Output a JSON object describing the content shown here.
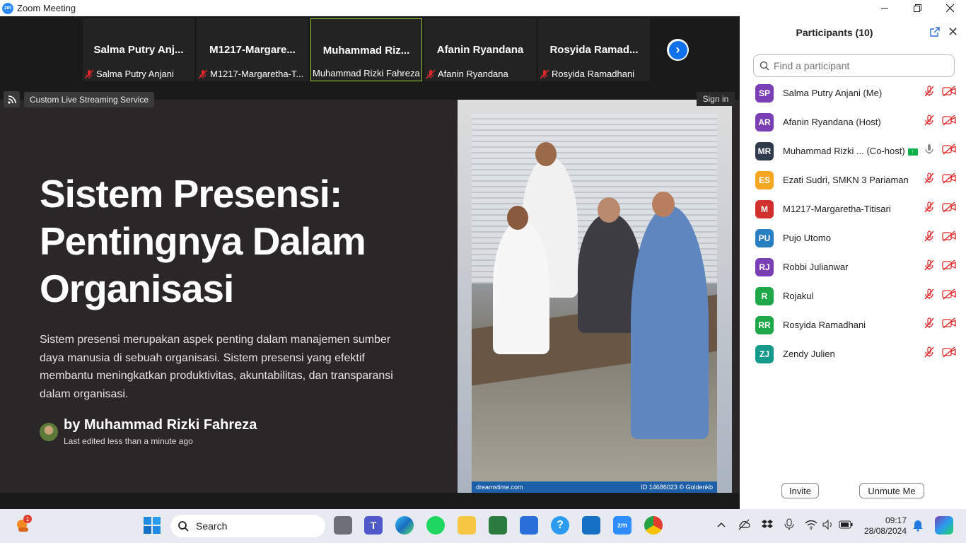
{
  "window": {
    "title": "Zoom Meeting",
    "app_badge": "zm"
  },
  "strip": {
    "tiles": [
      {
        "name": "Salma  Putry  Anj...",
        "label": "Salma Putry Anjani",
        "muted": true
      },
      {
        "name": "M1217-Margare...",
        "label": "M1217-Margaretha-T...",
        "muted": true
      },
      {
        "name": "Muhammad  Riz...",
        "label": "Muhammad Rizki Fahreza",
        "muted": false
      },
      {
        "name": "Afanin Ryandana",
        "label": "Afanin Ryandana",
        "muted": true
      },
      {
        "name": "Rosyida  Ramad...",
        "label": "Rosyida Ramadhani",
        "muted": true
      }
    ]
  },
  "live": {
    "label": "Custom Live Streaming Service"
  },
  "signin": "Sign in",
  "slide": {
    "title": "Sistem Presensi: Pentingnya Dalam Organisasi",
    "paragraph": "Sistem presensi merupakan aspek penting dalam manajemen sumber daya manusia di sebuah organisasi. Sistem presensi yang efektif membantu meningkatkan produktivitas, akuntabilitas, dan transparansi dalam organisasi.",
    "author": "by Muhammad Rizki Fahreza",
    "edited": "Last edited less than a minute ago",
    "photo_caption_left": "dreamstime.com",
    "photo_caption_right": "ID 14686023 © Goldenkb"
  },
  "participants": {
    "title": "Participants (10)",
    "search_placeholder": "Find a participant",
    "list": [
      {
        "initials": "SP",
        "name": "Salma Putry Anjani (Me)",
        "color": "#7b3fb5",
        "mic": "off"
      },
      {
        "initials": "AR",
        "name": "Afanin Ryandana (Host)",
        "color": "#7b3fb5",
        "mic": "off"
      },
      {
        "initials": "MR",
        "name": "Muhammad Rizki ...  (Co-host)",
        "color": "#2f3b4c",
        "mic": "on",
        "sharing": true
      },
      {
        "initials": "ES",
        "name": "Ezati Sudri, SMKN 3 Pariaman",
        "color": "#f5a623",
        "mic": "off"
      },
      {
        "initials": "M",
        "name": "M1217-Margaretha-Titisari",
        "color": "#d0312d",
        "mic": "off"
      },
      {
        "initials": "PU",
        "name": "Pujo Utomo",
        "color": "#2a7fc1",
        "mic": "off"
      },
      {
        "initials": "RJ",
        "name": "Robbi Julianwar",
        "color": "#7b3fb5",
        "mic": "off"
      },
      {
        "initials": "R",
        "name": "Rojakul",
        "color": "#1ea84a",
        "mic": "off"
      },
      {
        "initials": "RR",
        "name": "Rosyida Ramadhani",
        "color": "#1ea84a",
        "mic": "off"
      },
      {
        "initials": "ZJ",
        "name": "Zendy Julien",
        "color": "#159a8c",
        "mic": "off"
      }
    ],
    "invite": "Invite",
    "unmute": "Unmute Me"
  },
  "taskbar": {
    "search": "Search",
    "time": "09:17",
    "date": "28/08/2024",
    "notif_count": "1"
  }
}
